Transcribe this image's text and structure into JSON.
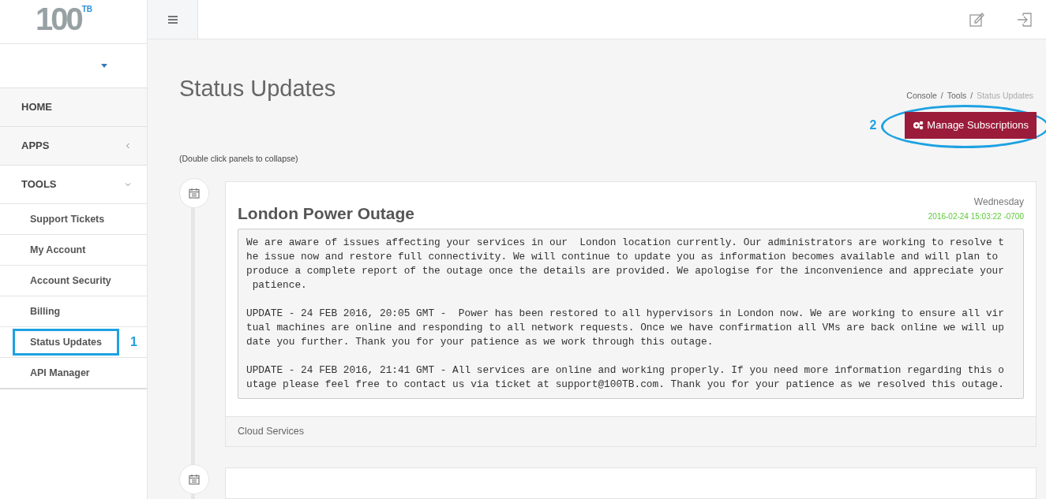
{
  "logo": {
    "text": "100",
    "sup": "TB"
  },
  "sidebar": {
    "items": [
      {
        "label": "HOME",
        "kind": "section",
        "expanded": false,
        "has_caret": false
      },
      {
        "label": "APPS",
        "kind": "section",
        "expanded": false,
        "has_caret": true
      },
      {
        "label": "TOOLS",
        "kind": "section",
        "expanded": true,
        "has_caret": true
      },
      {
        "label": "Support Tickets",
        "kind": "sub",
        "selected": false
      },
      {
        "label": "My Account",
        "kind": "sub",
        "selected": false
      },
      {
        "label": "Account Security",
        "kind": "sub",
        "selected": false
      },
      {
        "label": "Billing",
        "kind": "sub",
        "selected": false
      },
      {
        "label": "Status Updates",
        "kind": "sub",
        "selected": true,
        "annotation": "1"
      },
      {
        "label": "API Manager",
        "kind": "sub",
        "selected": false
      }
    ]
  },
  "page": {
    "title": "Status Updates",
    "breadcrumb": [
      "Console",
      "Tools",
      "Status Updates"
    ],
    "breadcrumb_separator": "/",
    "button": "Manage Subscriptions",
    "button_annotation": "2",
    "hint": "(Double click panels to collapse)"
  },
  "updates": [
    {
      "title": "London Power Outage",
      "day": "Wednesday",
      "timestamp": "2016-02-24 15:03:22 -0700",
      "body": "We are aware of issues affecting your services in our  London location currently. Our administrators are working to resolve t\nhe issue now and restore full connectivity. We will continue to update you as information becomes available and will plan to\nproduce a complete report of the outage once the details are provided. We apologise for the inconvenience and appreciate your\n patience.\n\nUPDATE - 24 FEB 2016, 20:05 GMT -  Power has been restored to all hypervisors in London now. We are working to ensure all vir\ntual machines are online and responding to all network requests. Once we have confirmation all VMs are back online we will up\ndate you further. Thank you for your patience as we work through this outage.\n\nUPDATE - 24 FEB 2016, 21:41 GMT - All services are online and working properly. If you need more information regarding this o\nutage please feel free to contact us via ticket at support@100TB.com. Thank you for your patience as we resolved this outage.",
      "footer": "Cloud Services"
    }
  ]
}
